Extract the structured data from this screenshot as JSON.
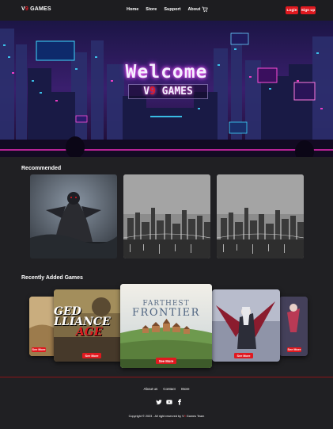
{
  "nav": {
    "brand_v": "V",
    "brand_9": "9",
    "brand_rest": " GAMES",
    "links": [
      "Home",
      "Store",
      "Support",
      "About"
    ],
    "login": "Login",
    "signup": "Sign up"
  },
  "hero": {
    "title": "Welcome",
    "sub_v": "V",
    "sub_9": "9",
    "sub_rest": " GAMES"
  },
  "recommended": {
    "title": "Recommended"
  },
  "recent": {
    "title": "Recently Added Games",
    "see_more": "See More",
    "center_title_1": "FARTHEST",
    "center_title_2": "FRONTIER",
    "left_title_1": "GED",
    "left_title_2": "LLIANCE",
    "left_title_3": "AGE"
  },
  "footer": {
    "links": [
      "About us",
      "Contact",
      "Store"
    ],
    "copy_prefix": "Copyright © 2023 - All right reserved by ",
    "copy_v": "V",
    "copy_9": "9",
    "copy_suffix": " Games Team"
  },
  "colors": {
    "accent": "#e0191f",
    "bg": "#202023"
  },
  "icons": [
    "cart-icon",
    "twitter-icon",
    "youtube-icon",
    "facebook-icon"
  ]
}
